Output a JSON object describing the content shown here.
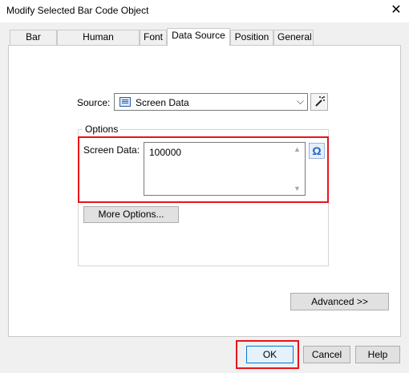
{
  "window": {
    "title": "Modify Selected Bar Code Object",
    "close_glyph": "✕"
  },
  "tabs": [
    "Bar Code",
    "Human Readable",
    "Font",
    "Data Source",
    "Position",
    "General"
  ],
  "active_tab": "Data Source",
  "source": {
    "label": "Source:",
    "value": "Screen Data",
    "icon": "screen-data-icon",
    "chevron": "⌵"
  },
  "options": {
    "legend": "Options",
    "screen_data_label": "Screen Data:",
    "screen_data_value": "100000",
    "omega_glyph": "Ω",
    "more_options_label": "More Options..."
  },
  "buttons": {
    "advanced": "Advanced >>",
    "ok": "OK",
    "cancel": "Cancel",
    "help": "Help"
  },
  "colors": {
    "highlight": "#e8141b",
    "focus": "#0078d7"
  }
}
